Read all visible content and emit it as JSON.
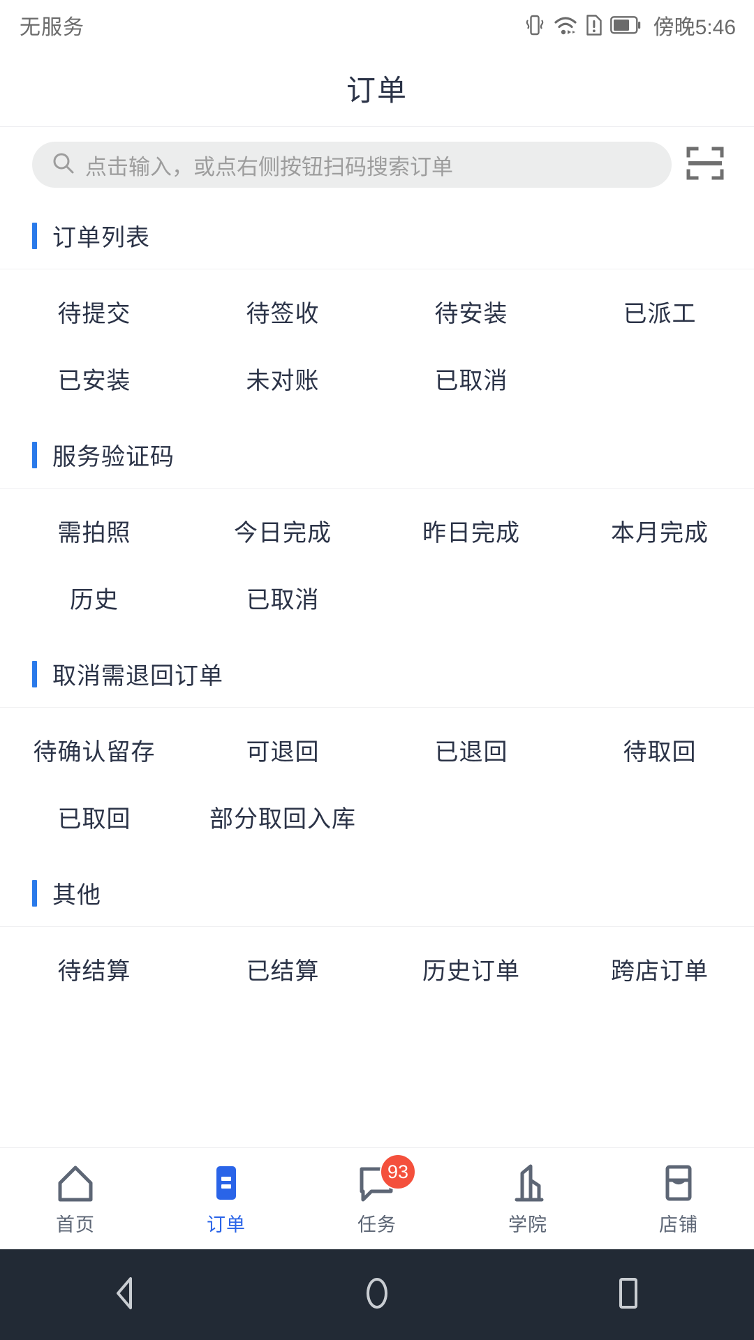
{
  "status_bar": {
    "carrier": "无服务",
    "time": "傍晚5:46",
    "icons": [
      "vibrate-icon",
      "wifi-icon",
      "sim-alert-icon",
      "battery-icon"
    ]
  },
  "header": {
    "title": "订单"
  },
  "search": {
    "placeholder": "点击输入，或点右侧按钮扫码搜索订单",
    "scan_icon": "scan-code-icon"
  },
  "sections": [
    {
      "title": "订单列表",
      "items": [
        "待提交",
        "待签收",
        "待安装",
        "已派工",
        "已安装",
        "未对账",
        "已取消"
      ]
    },
    {
      "title": "服务验证码",
      "items": [
        "需拍照",
        "今日完成",
        "昨日完成",
        "本月完成",
        "历史",
        "已取消"
      ]
    },
    {
      "title": "取消需退回订单",
      "items": [
        "待确认留存",
        "可退回",
        "已退回",
        "待取回",
        "已取回",
        "部分取回入库"
      ]
    },
    {
      "title": "其他",
      "items": [
        "待结算",
        "已结算",
        "历史订单",
        "跨店订单"
      ]
    }
  ],
  "tabbar": {
    "items": [
      {
        "label": "首页",
        "icon": "home-icon",
        "active": false,
        "badge": null
      },
      {
        "label": "订单",
        "icon": "order-list-icon",
        "active": true,
        "badge": null
      },
      {
        "label": "任务",
        "icon": "task-message-icon",
        "active": false,
        "badge": "93"
      },
      {
        "label": "学院",
        "icon": "academy-building-icon",
        "active": false,
        "badge": null
      },
      {
        "label": "店铺",
        "icon": "shop-icon",
        "active": false,
        "badge": null
      }
    ]
  },
  "android_nav": {
    "keys": [
      "back-icon",
      "home-circle-icon",
      "recents-square-icon"
    ]
  },
  "colors": {
    "accent": "#2a7aea",
    "tab_active": "#2a64e8",
    "badge": "#f4503c",
    "text": "#2b3347",
    "muted": "#9d9d9d",
    "section_gap": "#eef0f3",
    "nav_bg": "#222a35"
  }
}
